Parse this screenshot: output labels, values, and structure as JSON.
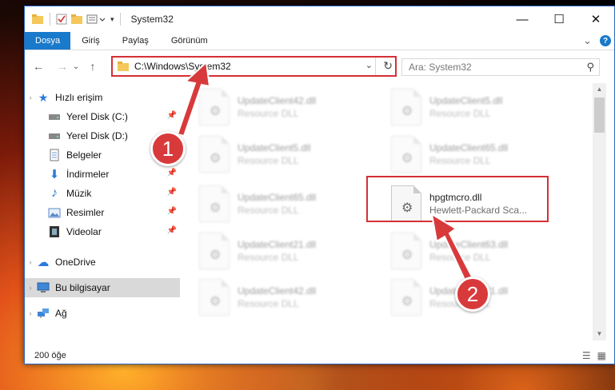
{
  "window": {
    "title": "System32",
    "controls": {
      "minimize": "—",
      "maximize": "☐",
      "close": "✕"
    }
  },
  "ribbon": {
    "tabs": [
      {
        "label": "Dosya",
        "active": true
      },
      {
        "label": "Giriş"
      },
      {
        "label": "Paylaş"
      },
      {
        "label": "Görünüm"
      }
    ],
    "collapse_glyph": "⌄",
    "help_glyph": "?"
  },
  "nav": {
    "back": "←",
    "forward": "→",
    "recent": "⌄",
    "up": "↑",
    "address": "C:\\Windows\\System32",
    "address_chevron": "⌄",
    "refresh": "↻",
    "search_placeholder": "Ara: System32",
    "search_glyph": "⚲"
  },
  "sidebar": {
    "items": [
      {
        "label": "Hızlı erişim",
        "icon": "star-icon",
        "glyph": "★"
      },
      {
        "label": "Yerel Disk (C:)",
        "icon": "drive-icon",
        "glyph": "▬",
        "pinned": true
      },
      {
        "label": "Yerel Disk (D:)",
        "icon": "drive-icon",
        "glyph": "▬"
      },
      {
        "label": "Belgeler",
        "icon": "documents-icon",
        "glyph": "▤"
      },
      {
        "label": "İndirmeler",
        "icon": "download-icon",
        "glyph": "⬇",
        "pinned": true
      },
      {
        "label": "Müzik",
        "icon": "music-icon",
        "glyph": "♪",
        "pinned": true
      },
      {
        "label": "Resimler",
        "icon": "pictures-icon",
        "glyph": "▣",
        "pinned": true
      },
      {
        "label": "Videolar",
        "icon": "video-icon",
        "glyph": "▦",
        "pinned": true
      },
      {
        "label": "OneDrive",
        "icon": "cloud-icon",
        "glyph": "☁"
      },
      {
        "label": "Bu bilgisayar",
        "icon": "computer-icon",
        "glyph": "▭",
        "selected": true
      },
      {
        "label": "Ağ",
        "icon": "network-icon",
        "glyph": "⌂"
      }
    ],
    "pin_glyph": "📌"
  },
  "files": [
    {
      "name": "UpdateClient42.dll",
      "desc": "Resource DLL",
      "blurred": true
    },
    {
      "name": "UpdateClient5.dll",
      "desc": "Resource DLL",
      "blurred": true
    },
    {
      "name": "UpdateClient5.dll",
      "desc": "Resource DLL",
      "blurred": true
    },
    {
      "name": "UpdateClient65.dll",
      "desc": "Resource DLL",
      "blurred": true
    },
    {
      "name": "UpdateClient65.dll",
      "desc": "Resource DLL",
      "blurred": true
    },
    {
      "name": "hpgtmcro.dll",
      "desc": "Hewlett-Packard Sca...",
      "blurred": false
    },
    {
      "name": "UpdateClient21.dll",
      "desc": "Resource DLL",
      "blurred": true
    },
    {
      "name": "UpdateClient63.dll",
      "desc": "Resource DLL",
      "blurred": true
    },
    {
      "name": "UpdateClient42.dll",
      "desc": "Resource DLL",
      "blurred": true
    },
    {
      "name": "UpdateClient21.dll",
      "desc": "Resource DLL",
      "blurred": true
    }
  ],
  "status": {
    "count": "200 öğe",
    "details_view_glyph": "☰",
    "tiles_view_glyph": "▦"
  },
  "callouts": [
    {
      "label": "1"
    },
    {
      "label": "2"
    }
  ],
  "colors": {
    "accent": "#1979ca",
    "highlight": "#d53034",
    "callout": "#d83a3c"
  }
}
